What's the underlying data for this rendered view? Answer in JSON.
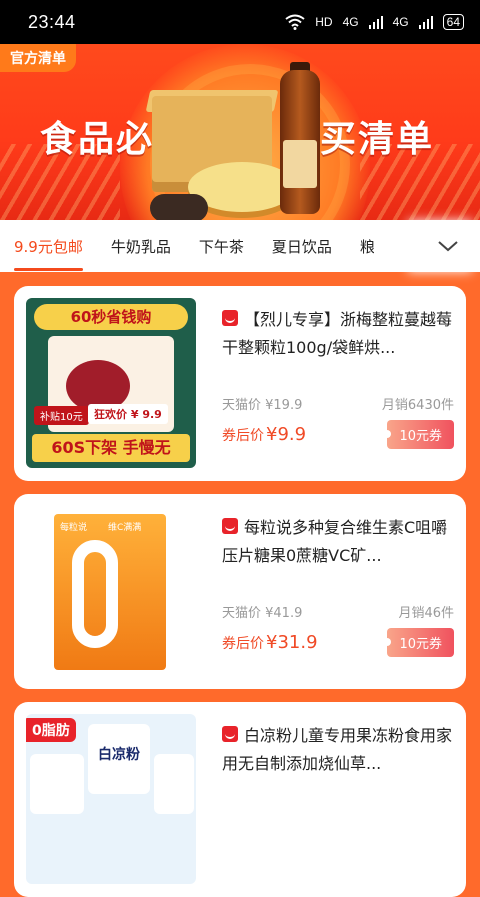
{
  "status": {
    "time": "23:44",
    "network": "HD",
    "signal1": "4G",
    "signal2": "4G",
    "battery": "64"
  },
  "banner": {
    "tag": "官方清单",
    "title_left": "食品必",
    "title_right": "买清单",
    "bottle_text": ""
  },
  "tabs": [
    {
      "label": "9.9元包邮",
      "active": true
    },
    {
      "label": "牛奶乳品",
      "active": false
    },
    {
      "label": "下午茶",
      "active": false
    },
    {
      "label": "夏日饮品",
      "active": false
    },
    {
      "label": "粮",
      "active": false
    }
  ],
  "products": [
    {
      "title": "【烈儿专享】浙梅整粒蔓越莓干整颗粒100g/袋鲜烘...",
      "tmall_price_label": "天猫价 ¥19.9",
      "sales": "月销6430件",
      "after_label": "券后价",
      "after_price": "¥9.9",
      "coupon": "10元券",
      "thumb": {
        "top_text": "60秒省钱购",
        "bottom_text": "60S下架 手慢无",
        "badge": "补贴10元",
        "price_tag": "狂欢价 ¥ 9.9"
      }
    },
    {
      "title": "每粒说多种复合维生素C咀嚼压片糖果0蔗糖VC矿...",
      "tmall_price_label": "天猫价 ¥41.9",
      "sales": "月销46件",
      "after_label": "券后价",
      "after_price": "¥31.9",
      "coupon": "10元券",
      "thumb": {
        "brand": "每粒说",
        "flavor": "维C满满",
        "big_text": "0"
      }
    },
    {
      "title": "白凉粉儿童专用果冻粉食用家用无自制添加烧仙草...",
      "tmall_price_label": "",
      "sales": "",
      "after_label": "",
      "after_price": "",
      "coupon": "",
      "thumb": {
        "badge": "0脂肪",
        "brand": "白凉粉"
      }
    }
  ],
  "colors": {
    "accent": "#f44a1c",
    "page_bg": "#ff6a2b",
    "tmall_red": "#e8232a"
  }
}
